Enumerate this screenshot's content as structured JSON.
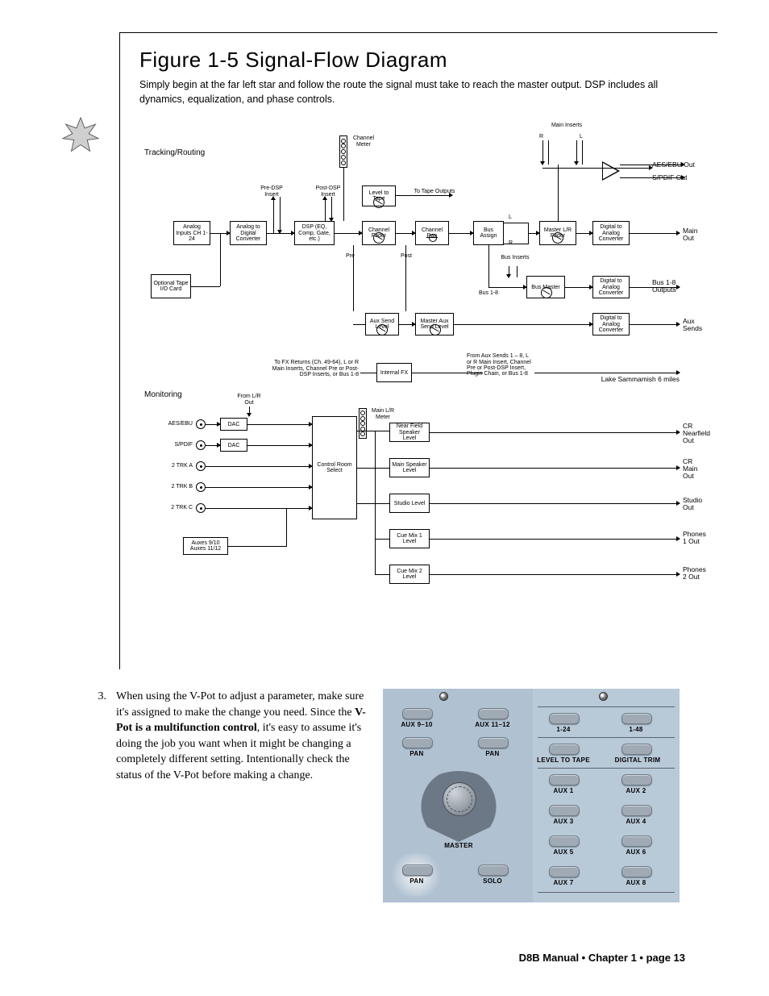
{
  "figure": {
    "title": "Figure 1-5 Signal-Flow Diagram",
    "caption": "Simply begin at the far left star and follow the route the signal must take to reach the master output. DSP includes all dynamics, equalization, and phase controls.",
    "sections": {
      "tracking": "Tracking/Routing",
      "monitoring": "Monitoring"
    },
    "tracking": {
      "pre_dsp_insert": "Pre-DSP Insert",
      "post_dsp_insert": "Post-DSP Insert",
      "channel_meter": "Channel Meter",
      "analog_inputs": "Analog Inputs CH 1-24",
      "adc": "Analog to Digital Converter",
      "dsp": "DSP (EQ, Comp, Gate, etc.)",
      "level_to_tape": "Level to Tape",
      "to_tape_outputs": "To Tape Outputs",
      "channel_fader": "Channel Fader",
      "channel_pan": "Channel Pan",
      "bus_assign": "Bus Assign",
      "optional_tape": "Optional Tape I/O Card",
      "pre": "Pre",
      "post": "Post",
      "l": "L",
      "r": "R",
      "main_inserts": "Main Inserts",
      "master_lr_fader": "Master L/R Fader",
      "bus_inserts": "Bus Inserts",
      "bus_1_8": "Bus 1-8",
      "bus_master": "Bus Master",
      "dac_main": "Digital to Analog Converter",
      "dac_bus": "Digital to Analog Converter",
      "dac_aux": "Digital to Analog Converter",
      "aux_send_level": "Aux Send Level",
      "master_aux_send": "Master Aux Send Level",
      "internal_fx": "Internal FX",
      "fx_returns_note": "To FX Returns (Ch. 49-64), L or R Main Inserts, Channel Pre or Post-DSP Inserts, or Bus 1-8",
      "from_aux_note": "From Aux Sends 1 – 8, L or R Main Insert, Channel Pre or Post-DSP Insert, Plugin Chain, or Bus 1-8",
      "lake": "Lake Sammamish 6 miles"
    },
    "outputs": {
      "aes_out": "AES/EBU Out",
      "spdif_out": "S/PDIF Out",
      "main_out": "Main Out",
      "bus_out": "Bus 1-8 Outputs",
      "aux_sends": "Aux Sends"
    },
    "monitoring": {
      "from_lr": "From L/R Out",
      "aes_ebu": "AES/EBU",
      "spdif": "S/PDIF",
      "trk_a": "2 TRK A",
      "trk_b": "2 TRK B",
      "trk_c": "2 TRK C",
      "auxes": "Auxes 9/10 Auxes 11/12",
      "dac": "DAC",
      "cr_select": "Control Room Select",
      "main_lr_meter": "Main L/R Meter",
      "near_field": "Near Field Speaker Level",
      "main_spk": "Main Speaker Level",
      "studio_level": "Studio Level",
      "cue1": "Cue Mix 1 Level",
      "cue2": "Cue Mix 2 Level"
    },
    "mon_outputs": {
      "cr_near": "CR Nearfield Out",
      "cr_main": "CR Main Out",
      "studio": "Studio Out",
      "phones1": "Phones 1 Out",
      "phones2": "Phones 2 Out"
    }
  },
  "body": {
    "item_num": "3.",
    "item3_a": "When using the V-Pot to adjust a parameter, make sure it's assigned to make the change you need. Since the ",
    "item3_bold": "V-Pot is a multifunction control",
    "item3_b": ", it's easy to assume it's doing the job you want when it might be changing a completely different setting. Intentionally check the status of the V-Pot before making a change."
  },
  "panel": {
    "aux910": "AUX 9–10",
    "aux1112": "AUX 11–12",
    "pan": "PAN",
    "master": "MASTER",
    "solo": "SOLO",
    "bank124": "1-24",
    "bank148": "1-48",
    "level_tape": "LEVEL TO TAPE",
    "digital_trim": "DIGITAL TRIM",
    "aux1": "AUX 1",
    "aux2": "AUX 2",
    "aux3": "AUX 3",
    "aux4": "AUX 4",
    "aux5": "AUX 5",
    "aux6": "AUX 6",
    "aux7": "AUX 7",
    "aux8": "AUX 8"
  },
  "footer": "D8B Manual • Chapter 1 • page  13"
}
